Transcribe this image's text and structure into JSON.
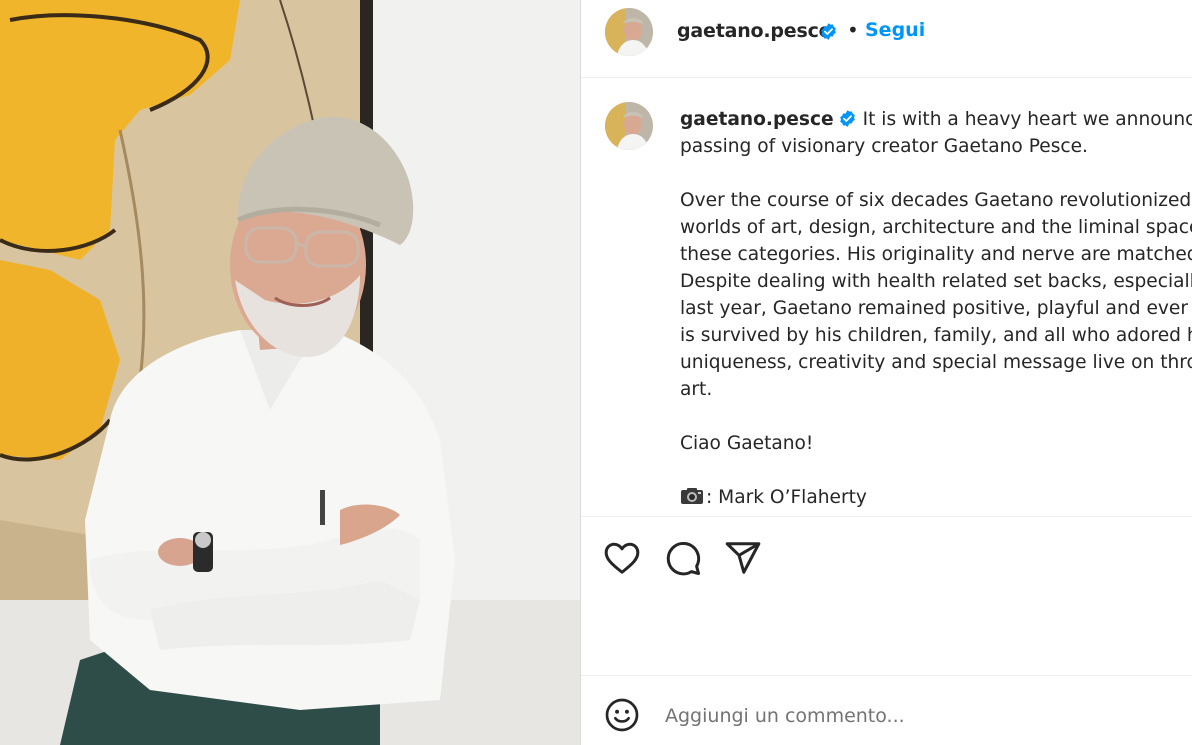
{
  "post": {
    "username": "gaetano.pesce",
    "verified": true,
    "separator": "•",
    "follow_label": "Segui"
  },
  "caption": {
    "username": "gaetano.pesce",
    "lines": [
      "It is with a heavy heart we announce the",
      "passing of visionary creator Gaetano Pesce.",
      "",
      "Over the course of six decades Gaetano revolutionized the",
      "worlds of art, design, architecture and the liminal spaces",
      "these categories. His originality and nerve are matched",
      "Despite dealing with health related set backs, especially",
      "last year, Gaetano remained positive, playful and ever cu",
      "is survived by his children, family, and all who adored hi",
      "uniqueness, creativity and special message live on throu",
      "art.",
      "",
      "Ciao Gaetano!",
      "",
      ": Mark O’Flaherty"
    ],
    "photo_credit_icon": "camera-emoji"
  },
  "actions": {
    "like_icon": "heart-icon",
    "comment_icon": "comment-bubble-icon",
    "share_icon": "paper-plane-icon"
  },
  "comment": {
    "placeholder": "Aggiungi un commento...",
    "emoji_icon": "smiley-icon"
  },
  "colors": {
    "accent": "#0095f6",
    "verified": "#0095f6",
    "text": "#262626",
    "placeholder": "#737373",
    "border": "#efefef"
  }
}
